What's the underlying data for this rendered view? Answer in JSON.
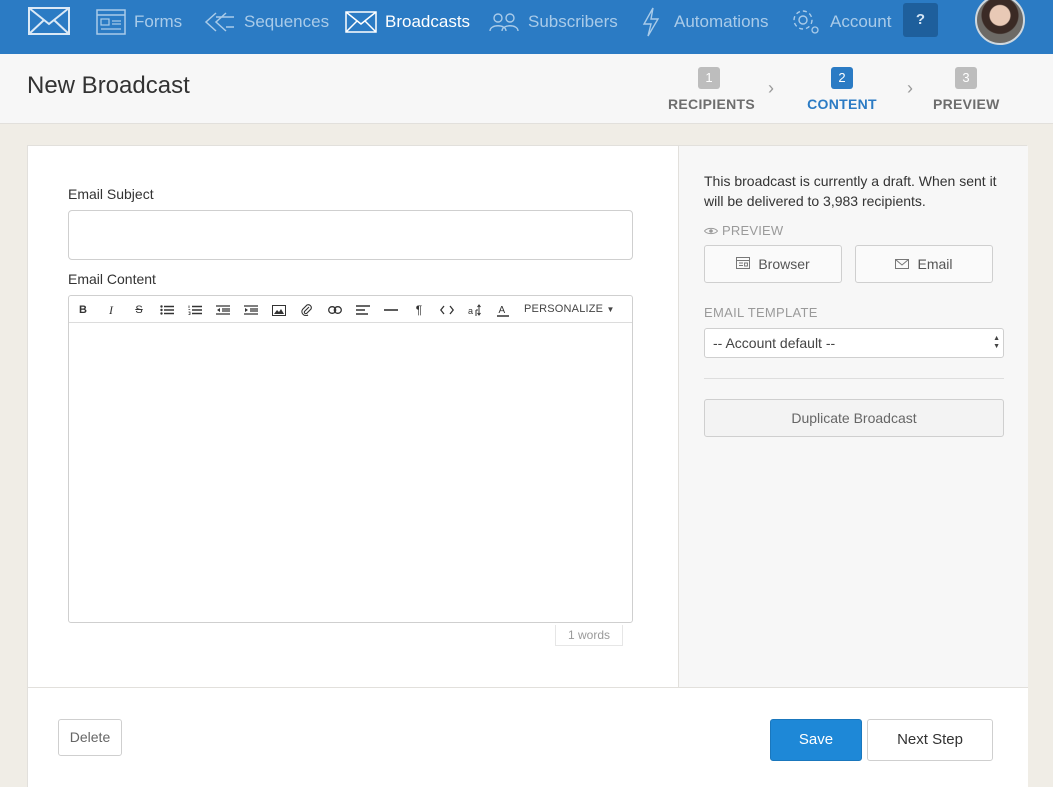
{
  "nav": {
    "items": [
      {
        "label": "Forms",
        "icon": "form-icon"
      },
      {
        "label": "Sequences",
        "icon": "sequence-arrows-icon"
      },
      {
        "label": "Broadcasts",
        "icon": "envelope-icon"
      },
      {
        "label": "Subscribers",
        "icon": "people-icon"
      },
      {
        "label": "Automations",
        "icon": "lightning-icon"
      },
      {
        "label": "Account",
        "icon": "gear-icon"
      }
    ],
    "active": "Broadcasts",
    "help_label": "?"
  },
  "header": {
    "title": "New Broadcast",
    "steps": [
      {
        "num": "1",
        "label": "RECIPIENTS"
      },
      {
        "num": "2",
        "label": "CONTENT"
      },
      {
        "num": "3",
        "label": "PREVIEW"
      }
    ],
    "active_step": "CONTENT"
  },
  "editor": {
    "subject_label": "Email Subject",
    "subject_value": "",
    "content_label": "Email Content",
    "toolbar_icons": [
      "bold-icon",
      "italic-icon",
      "strikethrough-icon",
      "bullet-list-icon",
      "numbered-list-icon",
      "outdent-icon",
      "indent-icon",
      "image-icon",
      "attachment-icon",
      "link-icon",
      "align-icon",
      "horizontal-rule-icon",
      "paragraph-icon",
      "code-icon",
      "font-size-icon",
      "font-color-icon"
    ],
    "personalize_label": "PERSONALIZE",
    "word_count": "1 words"
  },
  "sidebar": {
    "draft_note": "This broadcast is currently a draft. When sent it will be delivered to 3,983 recipients.",
    "preview_label": "PREVIEW",
    "browser_label": "Browser",
    "email_label": "Email",
    "template_label": "EMAIL TEMPLATE",
    "template_value": "-- Account default --",
    "duplicate_label": "Duplicate Broadcast"
  },
  "footer": {
    "delete_label": "Delete",
    "save_label": "Save",
    "next_label": "Next Step"
  },
  "colors": {
    "nav_bg": "#2b7bc4",
    "accent": "#1e88d7",
    "page_bg": "#f0ede6"
  }
}
